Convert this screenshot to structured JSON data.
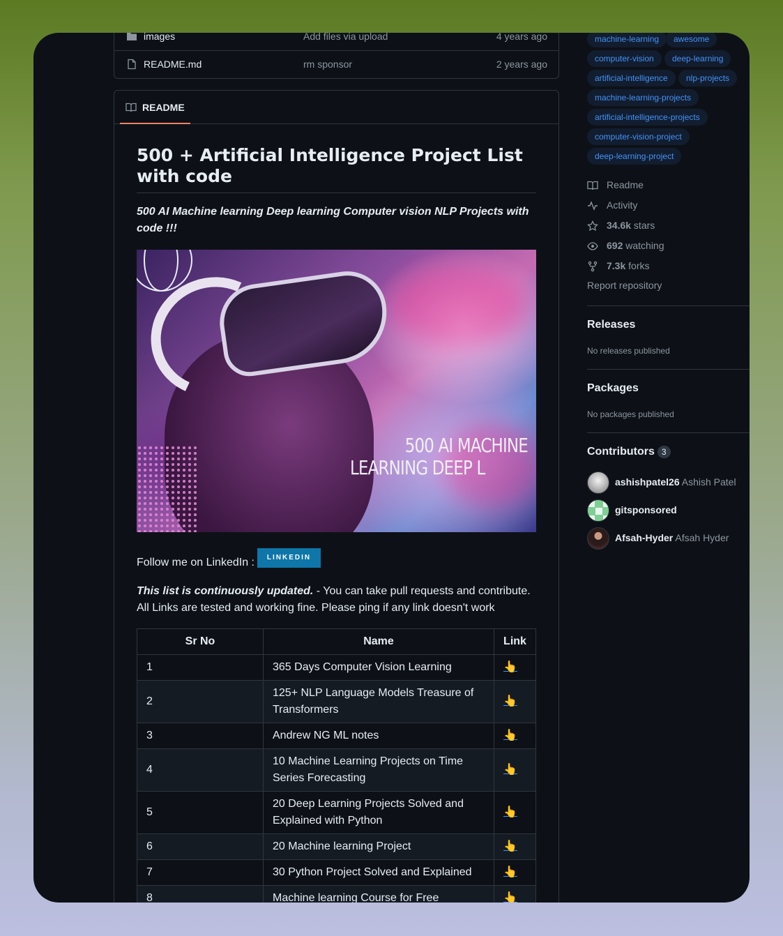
{
  "files": [
    {
      "name": "images",
      "message": "Add files via upload",
      "date": "4 years ago",
      "icon": "folder-icon"
    },
    {
      "name": "README.md",
      "message": "rm sponsor",
      "date": "2 years ago",
      "icon": "file-icon"
    }
  ],
  "readme": {
    "tab_label": "README",
    "title": "500 + Artificial Intelligence Project List with code",
    "subtitle": "500 AI Machine learning Deep learning Computer vision NLP Projects with code !!!",
    "hero_text_line1": "500 AI MACHINE",
    "hero_text_line2": "LEARNING DEEP L",
    "follow_text": "Follow me on LinkedIn :",
    "linkedin_badge": "LINKEDIN",
    "para_bold": "This list is continuously updated.",
    "para_rest": " - You can take pull requests and contribute. All Links are tested and working fine. Please ping if any link doesn't work",
    "table": {
      "headers": [
        "Sr No",
        "Name",
        "Link"
      ],
      "rows": [
        {
          "no": "1",
          "name": "365 Days Computer Vision Learning",
          "link": "👆"
        },
        {
          "no": "2",
          "name": "125+ NLP Language Models Treasure of Transformers",
          "link": "👆"
        },
        {
          "no": "3",
          "name": "Andrew NG ML notes",
          "link": "👆"
        },
        {
          "no": "4",
          "name": "10 Machine Learning Projects on Time Series Forecasting",
          "link": "👆"
        },
        {
          "no": "5",
          "name": "20 Deep Learning Projects Solved and Explained with Python",
          "link": "👆"
        },
        {
          "no": "6",
          "name": "20 Machine learning Project",
          "link": "👆"
        },
        {
          "no": "7",
          "name": "30 Python Project Solved and Explained",
          "link": "👆"
        },
        {
          "no": "8",
          "name": "Machine learning Course for Free",
          "link": "👆"
        }
      ]
    }
  },
  "sidebar": {
    "topics": [
      "machine-learning",
      "awesome",
      "computer-vision",
      "deep-learning",
      "artificial-intelligence",
      "nlp-projects",
      "machine-learning-projects",
      "artificial-intelligence-projects",
      "computer-vision-project",
      "deep-learning-project"
    ],
    "meta": {
      "readme": "Readme",
      "activity": "Activity",
      "stars_count": "34.6k",
      "stars_label": " stars",
      "watching_count": "692",
      "watching_label": " watching",
      "forks_count": "7.3k",
      "forks_label": " forks",
      "report": "Report repository"
    },
    "releases": {
      "title": "Releases",
      "empty": "No releases published"
    },
    "packages": {
      "title": "Packages",
      "empty": "No packages published"
    },
    "contributors": {
      "title": "Contributors",
      "count": "3",
      "list": [
        {
          "login": "ashishpatel26",
          "name": "Ashish Patel"
        },
        {
          "login": "gitsponsored",
          "name": ""
        },
        {
          "login": "Afsah-Hyder",
          "name": "Afsah Hyder"
        }
      ]
    }
  },
  "colors": {
    "accent": "#4493f8",
    "tab_underline": "#f78166",
    "bg": "#0d1117",
    "linkedin": "#0e76a8"
  }
}
